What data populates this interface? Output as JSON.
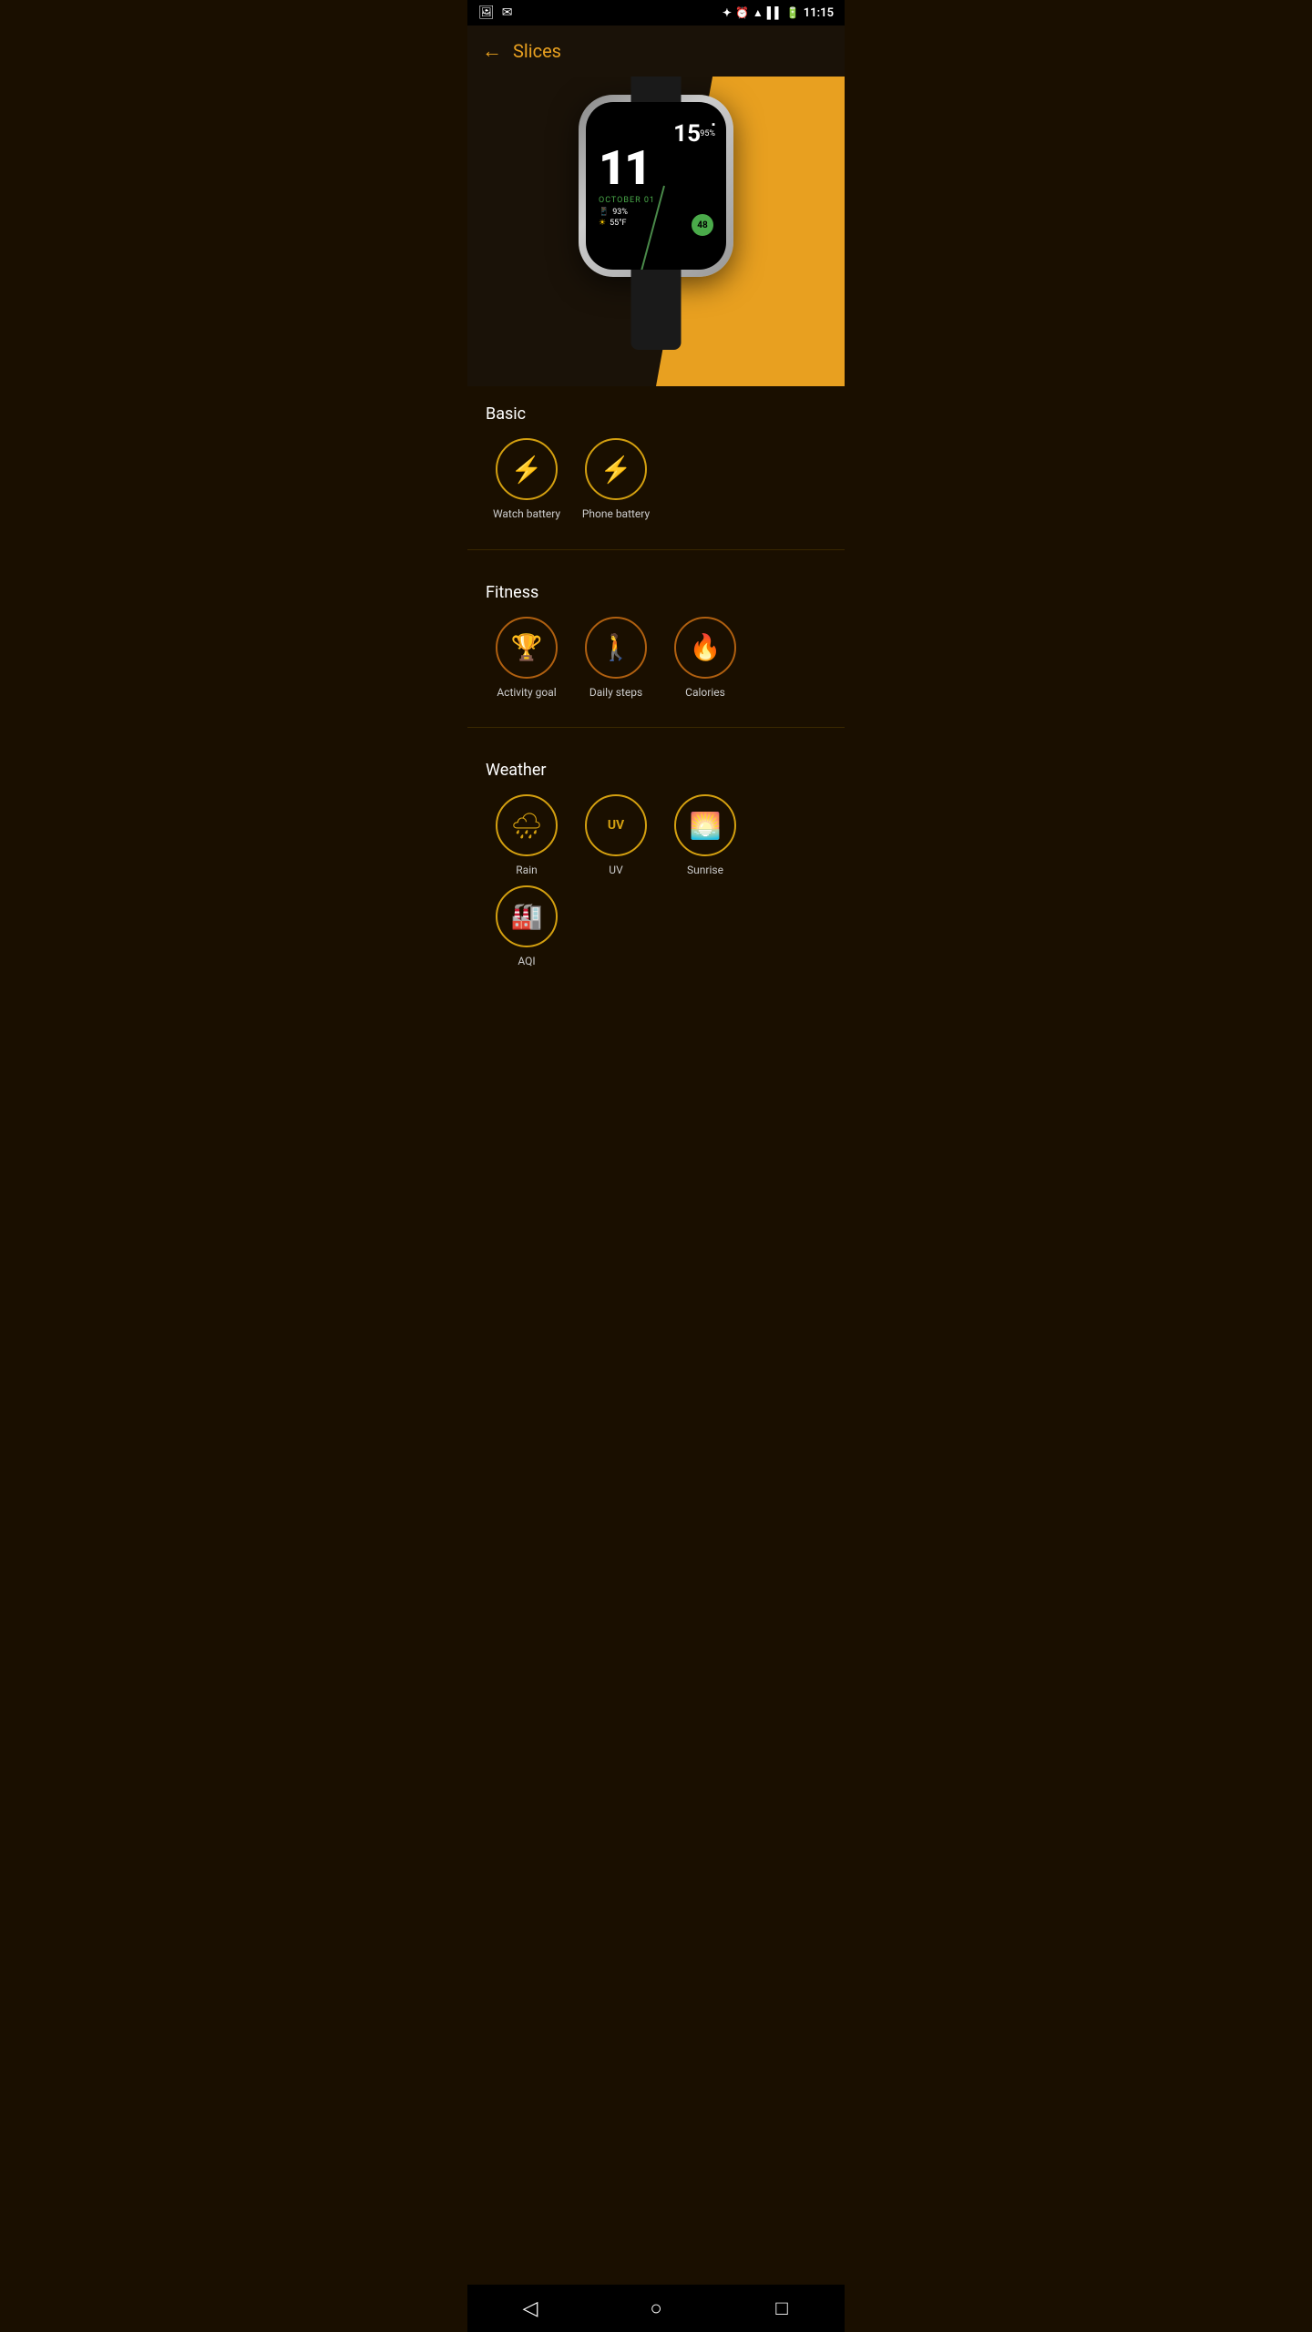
{
  "statusBar": {
    "time": "11:15",
    "icons": [
      "bluetooth",
      "alarm",
      "wifi",
      "signal",
      "battery"
    ]
  },
  "topBar": {
    "backLabel": "←",
    "title": "Slices"
  },
  "watchFace": {
    "hour": "11",
    "minutes": "15",
    "batteryPercent": "95%",
    "date": "OCTOBER 01",
    "phonePercent": "93%",
    "temperature": "55°F",
    "stepsBadge": "48"
  },
  "basic": {
    "sectionTitle": "Basic",
    "items": [
      {
        "id": "watch-battery",
        "label": "Watch battery",
        "icon": "🔋",
        "colorClass": "yellow"
      },
      {
        "id": "phone-battery",
        "label": "Phone battery",
        "icon": "🔋",
        "colorClass": "yellow"
      }
    ]
  },
  "fitness": {
    "sectionTitle": "Fitness",
    "items": [
      {
        "id": "activity-goal",
        "label": "Activity goal",
        "icon": "🏆",
        "colorClass": "orange"
      },
      {
        "id": "daily-steps",
        "label": "Daily steps",
        "icon": "🚶",
        "colorClass": "orange"
      },
      {
        "id": "calories",
        "label": "Calories",
        "icon": "🔥",
        "colorClass": "orange"
      }
    ]
  },
  "weather": {
    "sectionTitle": "Weather",
    "items": [
      {
        "id": "rain",
        "label": "Rain",
        "icon": "🌧",
        "colorClass": "yellow"
      },
      {
        "id": "uv",
        "label": "UV",
        "icon": "UV",
        "colorClass": "yellow"
      },
      {
        "id": "sunrise",
        "label": "Sunrise",
        "icon": "🌅",
        "colorClass": "yellow"
      },
      {
        "id": "aqi",
        "label": "AQI",
        "icon": "🏭",
        "colorClass": "yellow"
      }
    ]
  },
  "navBar": {
    "back": "◁",
    "home": "○",
    "recent": "□"
  }
}
